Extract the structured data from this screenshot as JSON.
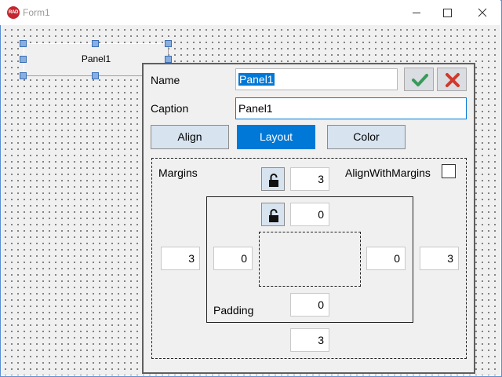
{
  "window": {
    "title": "Form1",
    "logo_text": "RAD"
  },
  "panel": {
    "caption": "Panel1"
  },
  "editor": {
    "name_label": "Name",
    "name_value": "Panel1",
    "caption_label": "Caption",
    "caption_value": "Panel1",
    "tabs": [
      {
        "label": "Align",
        "active": false
      },
      {
        "label": "Layout",
        "active": true
      },
      {
        "label": "Color",
        "active": false
      }
    ],
    "margins_label": "Margins",
    "padding_label": "Padding",
    "align_with_margins_label": "AlignWithMargins",
    "align_with_margins_checked": false,
    "margins": {
      "top": "3",
      "left": "3",
      "right": "3",
      "bottom": "3"
    },
    "padding": {
      "top": "0",
      "left": "0",
      "right": "0",
      "bottom": "0"
    }
  },
  "colors": {
    "accent": "#0078d7",
    "ok": "#3a9a5b",
    "cancel": "#d0392b",
    "logo": "#c4262e"
  }
}
